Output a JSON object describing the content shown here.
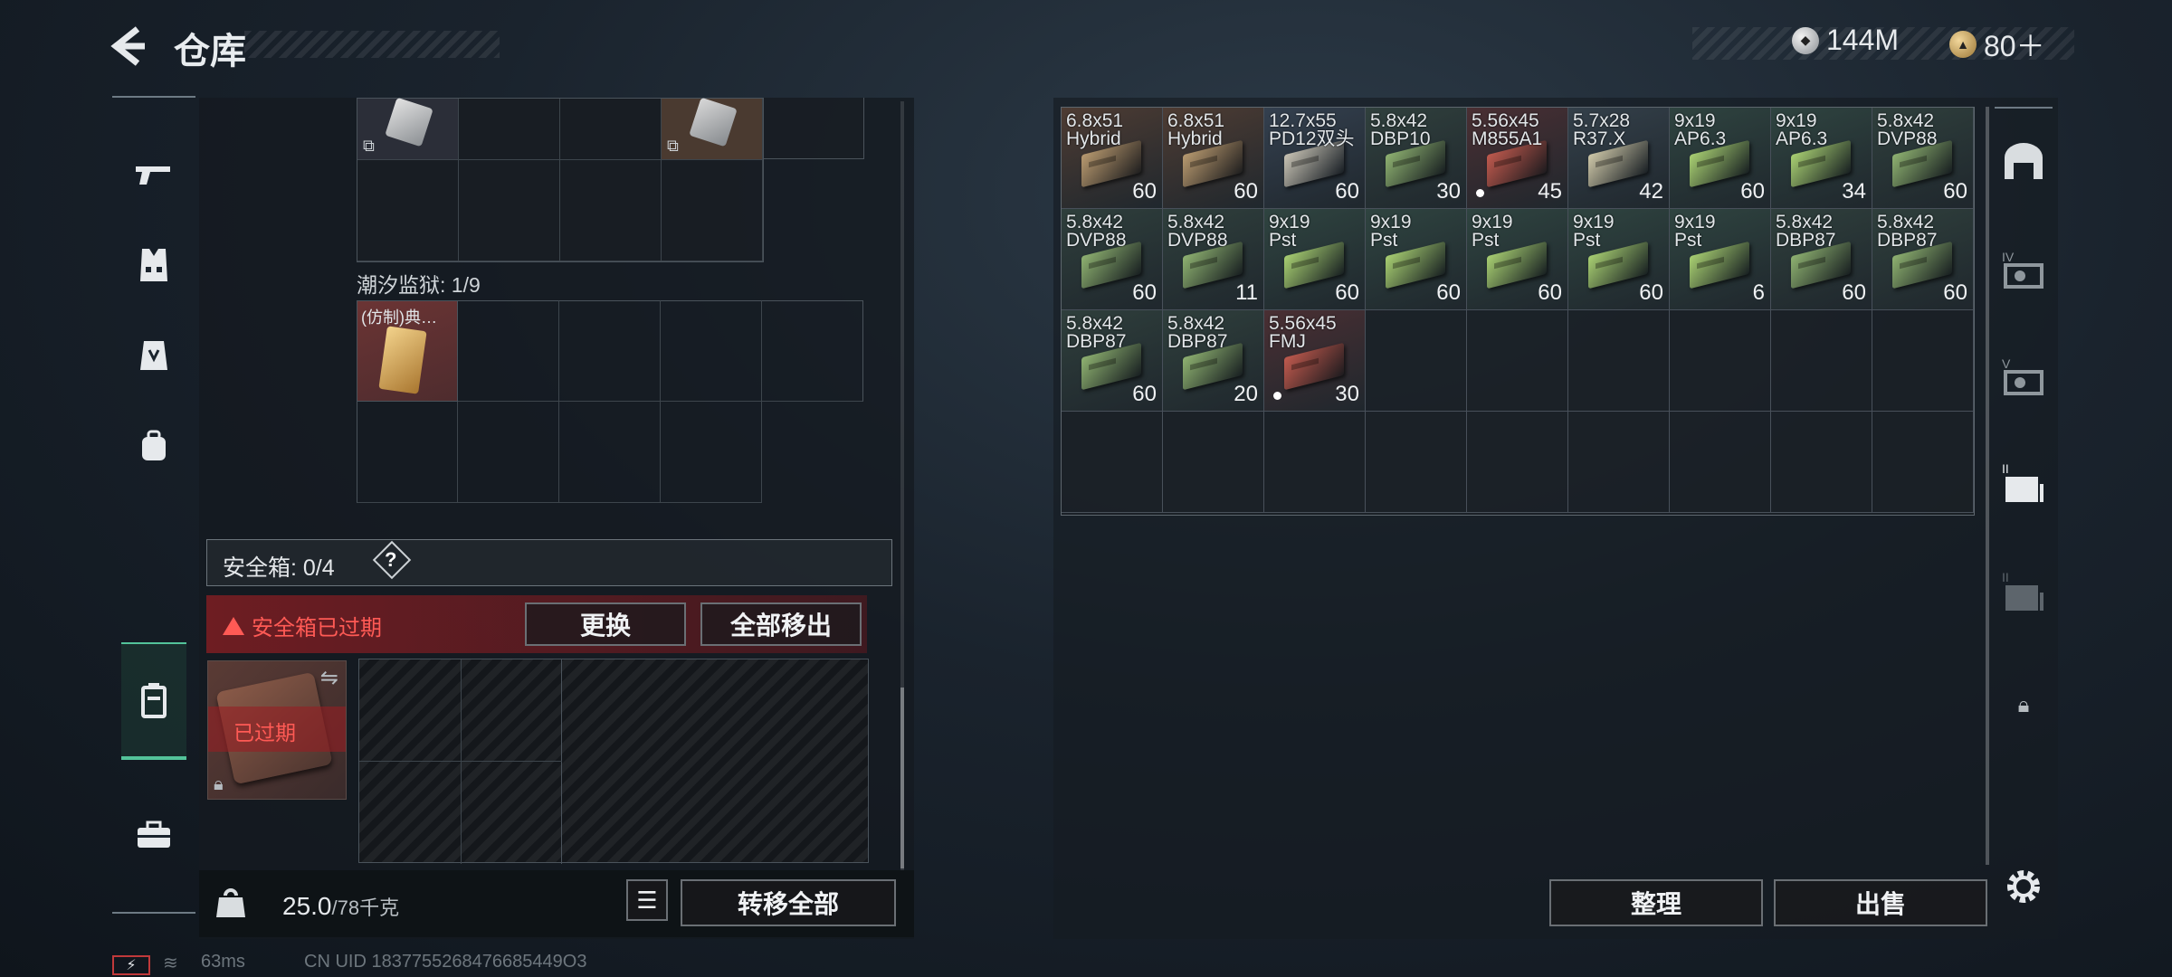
{
  "header": {
    "title": "仓库",
    "currency_1": "144M",
    "currency_2": "80＋"
  },
  "left_panel": {
    "section_label": "潮汐监狱: 1/9",
    "item_name": "(仿制)典…",
    "safebox_label": "安全箱: 0/4",
    "help_symbol": "?",
    "expired_message": "安全箱已过期",
    "replace_button": "更换",
    "remove_all_button": "全部移出",
    "secure_item_badge": "已过期",
    "weight_value": "25.0",
    "weight_max": "/78千克",
    "transfer_all_button": "转移全部"
  },
  "storage": {
    "items": [
      {
        "name1": "6.8x51",
        "name2": "Hybrid",
        "count": "60",
        "box_color": "#b89a70",
        "bg": "#4e3c33",
        "dot": false
      },
      {
        "name1": "6.8x51",
        "name2": "Hybrid",
        "count": "60",
        "box_color": "#b89a70",
        "bg": "#4e3c33",
        "dot": false
      },
      {
        "name1": "12.7x55",
        "name2": "PD12双头",
        "count": "60",
        "box_color": "#c8c3b4",
        "bg": "#34404f",
        "dot": false
      },
      {
        "name1": "5.8x42",
        "name2": "DBP10",
        "count": "30",
        "box_color": "#8fb271",
        "bg": "#30403d",
        "dot": false
      },
      {
        "name1": "5.56x45",
        "name2": "M855A1",
        "count": "45",
        "box_color": "#c05a4e",
        "bg": "#4a2f33",
        "dot": true
      },
      {
        "name1": "5.7x28",
        "name2": "R37.X",
        "count": "42",
        "box_color": "#cfc8a8",
        "bg": "#34404a",
        "dot": false
      },
      {
        "name1": "9x19",
        "name2": "AP6.3",
        "count": "60",
        "box_color": "#a9d072",
        "bg": "#2f4440",
        "dot": false
      },
      {
        "name1": "9x19",
        "name2": "AP6.3",
        "count": "34",
        "box_color": "#a9d072",
        "bg": "#2f4440",
        "dot": false
      },
      {
        "name1": "5.8x42",
        "name2": "DVP88",
        "count": "60",
        "box_color": "#8fb271",
        "bg": "#2f3f3c",
        "dot": false
      },
      {
        "name1": "5.8x42",
        "name2": "DVP88",
        "count": "60",
        "box_color": "#8fb271",
        "bg": "#2f3f3c",
        "dot": false
      },
      {
        "name1": "5.8x42",
        "name2": "DVP88",
        "count": "11",
        "box_color": "#8fb271",
        "bg": "#2f3f3c",
        "dot": false
      },
      {
        "name1": "9x19",
        "name2": "Pst",
        "count": "60",
        "box_color": "#a9d072",
        "bg": "#2f4440",
        "dot": false
      },
      {
        "name1": "9x19",
        "name2": "Pst",
        "count": "60",
        "box_color": "#a9d072",
        "bg": "#2f4440",
        "dot": false
      },
      {
        "name1": "9x19",
        "name2": "Pst",
        "count": "60",
        "box_color": "#a9d072",
        "bg": "#2f4440",
        "dot": false
      },
      {
        "name1": "9x19",
        "name2": "Pst",
        "count": "60",
        "box_color": "#a9d072",
        "bg": "#2f4440",
        "dot": false
      },
      {
        "name1": "9x19",
        "name2": "Pst",
        "count": "6",
        "box_color": "#a9d072",
        "bg": "#2f4440",
        "dot": false
      },
      {
        "name1": "5.8x42",
        "name2": "DBP87",
        "count": "60",
        "box_color": "#8fb271",
        "bg": "#2f3f3c",
        "dot": false
      },
      {
        "name1": "5.8x42",
        "name2": "DBP87",
        "count": "60",
        "box_color": "#8fb271",
        "bg": "#2f3f3c",
        "dot": false
      },
      {
        "name1": "5.8x42",
        "name2": "DBP87",
        "count": "60",
        "box_color": "#8fb271",
        "bg": "#2f3f3c",
        "dot": false
      },
      {
        "name1": "5.8x42",
        "name2": "DBP87",
        "count": "20",
        "box_color": "#8fb271",
        "bg": "#2f3f3c",
        "dot": false
      },
      {
        "name1": "5.56x45",
        "name2": "FMJ",
        "count": "30",
        "box_color": "#c05a4e",
        "bg": "#4a2f33",
        "dot": true
      }
    ],
    "sort_button": "整理",
    "sell_button": "出售"
  },
  "status_bar": {
    "ping": "63ms",
    "uid": "CN UID 1837755268476685449O3"
  },
  "colors": {
    "accent_green": "#53c39a",
    "alert_red": "#ff5a55"
  }
}
